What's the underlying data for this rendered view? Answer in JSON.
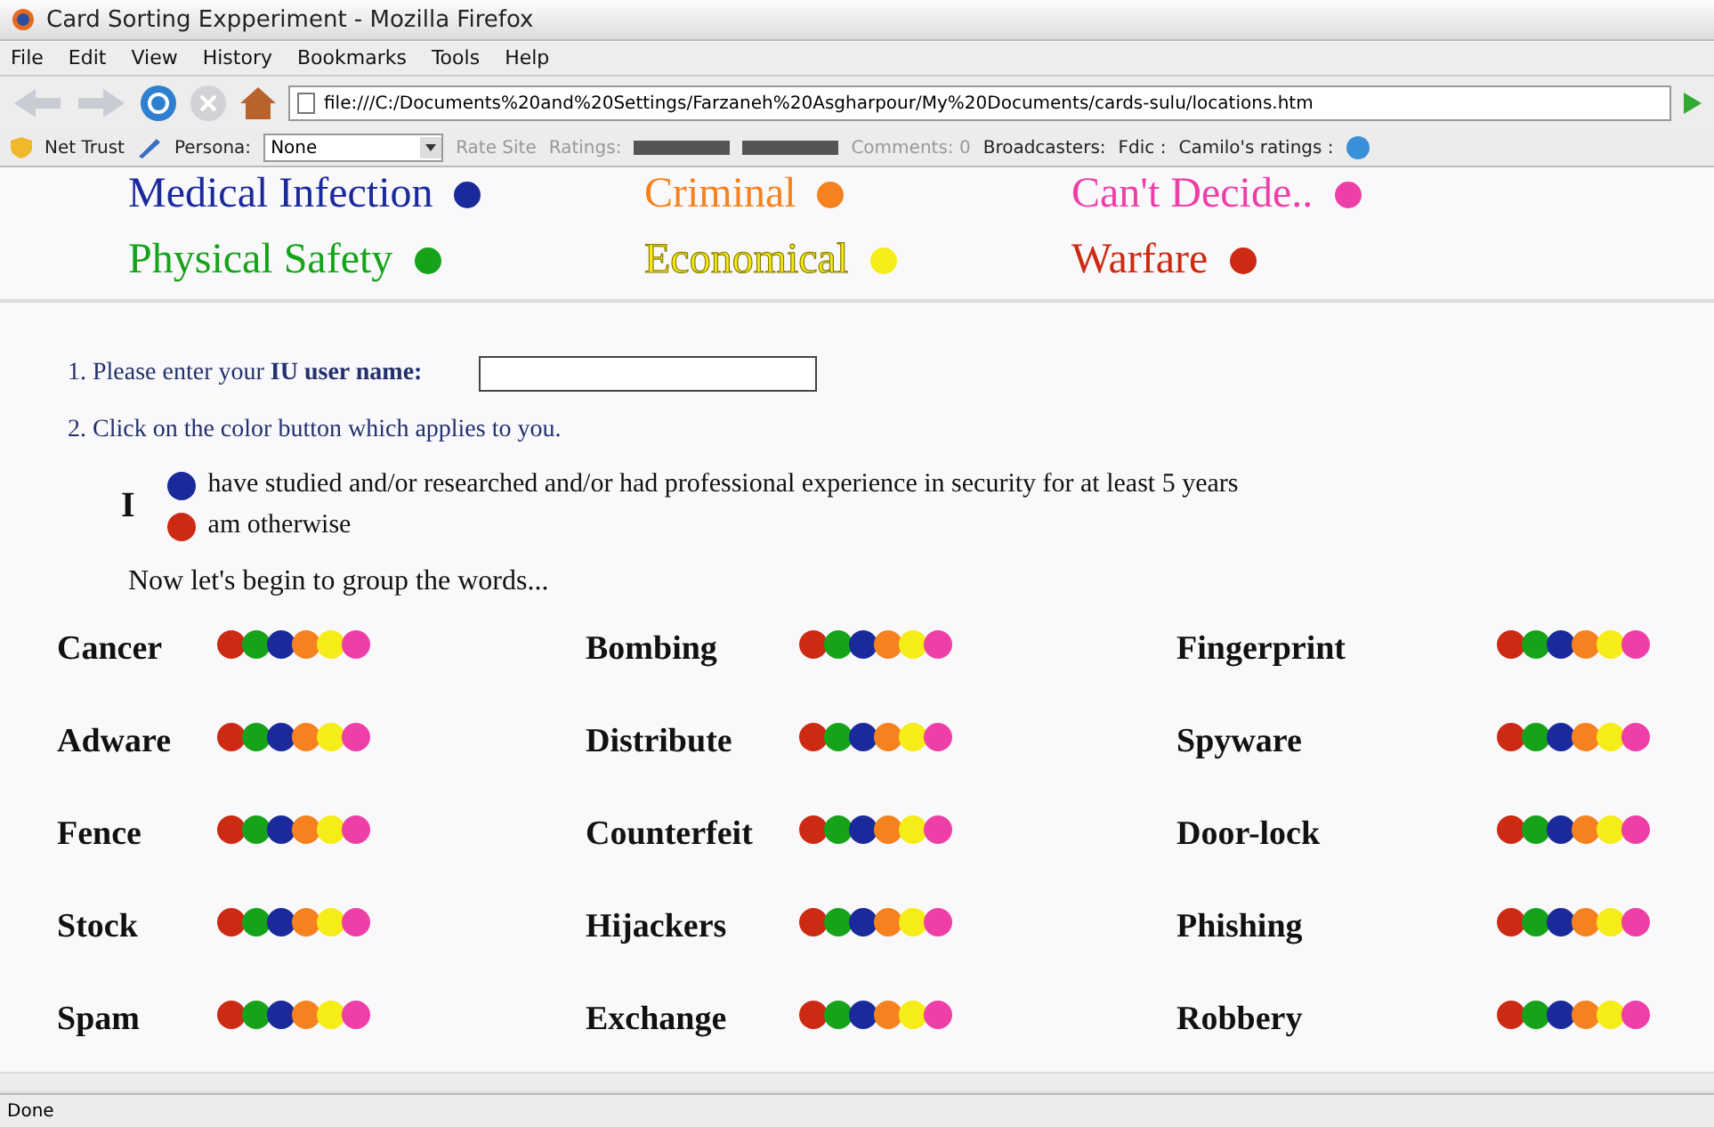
{
  "window": {
    "title": "Card Sorting Expperiment - Mozilla Firefox"
  },
  "menu": [
    "File",
    "Edit",
    "View",
    "History",
    "Bookmarks",
    "Tools",
    "Help"
  ],
  "address": {
    "value": "file:///C:/Documents%20and%20Settings/Farzaneh%20Asgharpour/My%20Documents/cards-sulu/locations.htm"
  },
  "toolbar": {
    "net_trust": "Net Trust",
    "persona_label": "Persona:",
    "persona_value": "None",
    "rate_site": "Rate Site",
    "ratings": "Ratings:",
    "comments": "Comments: 0",
    "broadcasters": "Broadcasters:",
    "fdic": "Fdic :",
    "camilo": "Camilo's ratings :"
  },
  "legend": [
    {
      "label": "Medical Infection",
      "color": "#1a2a9a"
    },
    {
      "label": "Criminal",
      "color": "#f5821f"
    },
    {
      "label": "Can't Decide..",
      "color": "#ee3fa8"
    },
    {
      "label": "Physical Safety",
      "color": "#16a31a"
    },
    {
      "label": "Economical",
      "color": "#f6ec17"
    },
    {
      "label": "Warfare",
      "color": "#cc2a12"
    }
  ],
  "question1": {
    "prefix": "1. Please enter your ",
    "bold": "IU user name:"
  },
  "question2": "2. Click on the color button which applies to you.",
  "subject": "I",
  "options": [
    {
      "text": "have studied and/or researched and/or had professional experience in security for at least 5 years",
      "color": "#1a2a9a"
    },
    {
      "text": "am otherwise",
      "color": "#cc2a12"
    }
  ],
  "intro": "Now let's begin to group the words...",
  "dot_colors": [
    {
      "color": "#cc2a12"
    },
    {
      "color": "#16a31a"
    },
    {
      "color": "#1a2a9a"
    },
    {
      "color": "#f5821f"
    },
    {
      "color": "#f6ec17"
    },
    {
      "color": "#ee3fa8"
    }
  ],
  "words": [
    "Cancer",
    "Bombing",
    "Fingerprint",
    "Adware",
    "Distribute",
    "Spyware",
    "Fence",
    "Counterfeit",
    "Door-lock",
    "Stock",
    "Hijackers",
    "Phishing",
    "Spam",
    "Exchange",
    "Robbery"
  ],
  "status_bar": "Done"
}
